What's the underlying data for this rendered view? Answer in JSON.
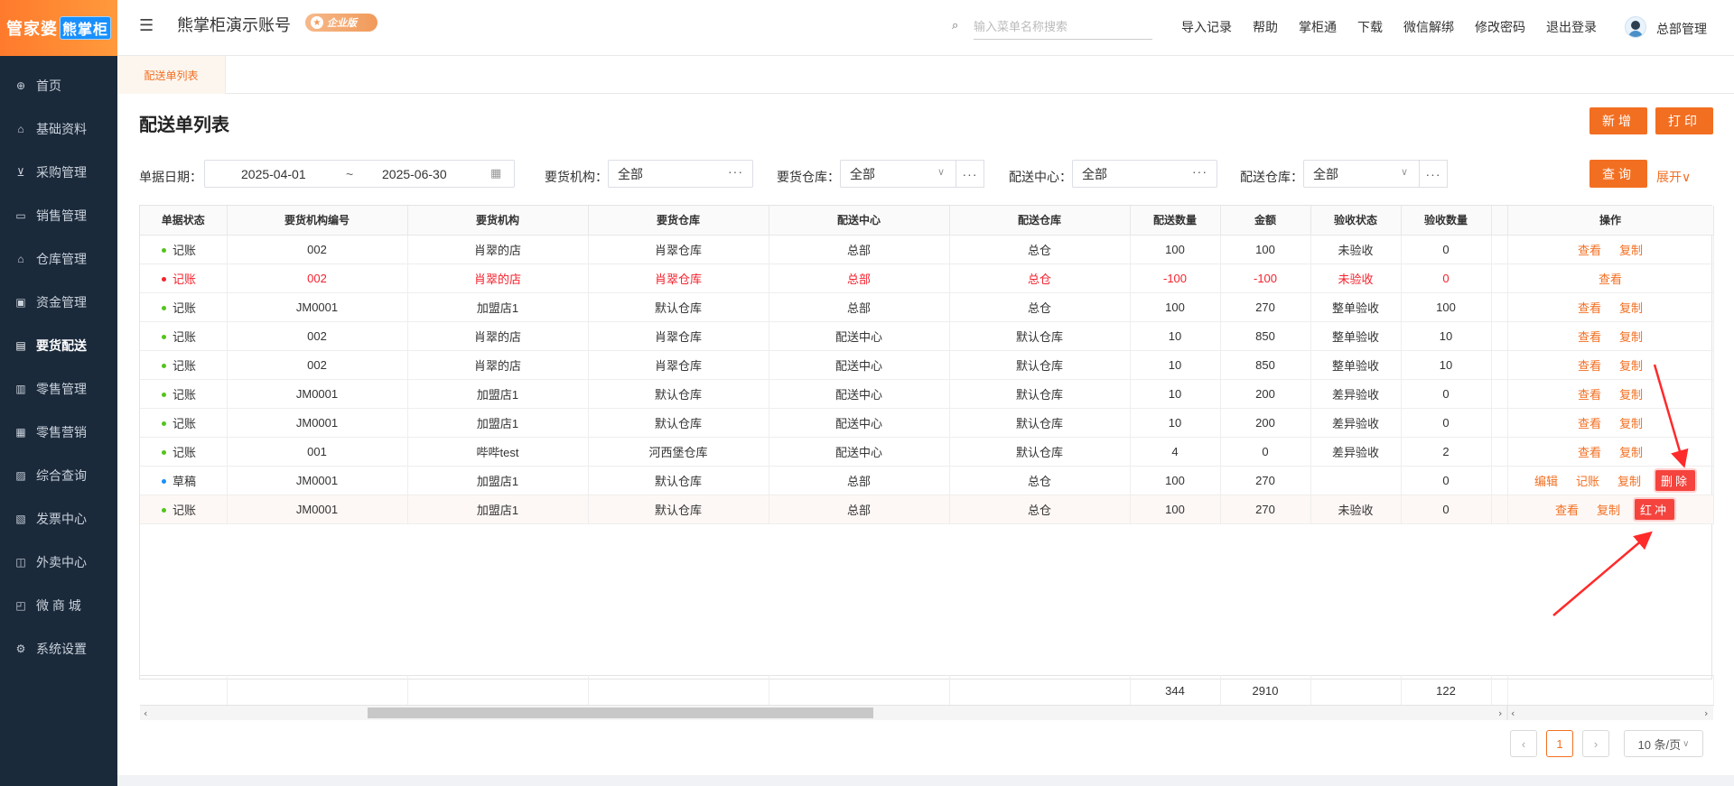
{
  "app": {
    "logo_text": "管家婆",
    "logo_sub": "熊掌柜",
    "account_title": "熊掌柜演示账号",
    "badge": "企业版"
  },
  "header": {
    "search_placeholder": "输入菜单名称搜索",
    "links": [
      "导入记录",
      "帮助",
      "掌柜通",
      "下载",
      "微信解绑",
      "修改密码",
      "退出登录"
    ],
    "user_name": "总部管理"
  },
  "sidebar": {
    "items": [
      {
        "label": "首页",
        "icon": "globe-icon",
        "glyph": "⊕"
      },
      {
        "label": "基础资料",
        "icon": "home-icon",
        "glyph": "⌂"
      },
      {
        "label": "采购管理",
        "icon": "cart-icon",
        "glyph": "⊻"
      },
      {
        "label": "销售管理",
        "icon": "sales-icon",
        "glyph": "▭"
      },
      {
        "label": "仓库管理",
        "icon": "warehouse-icon",
        "glyph": "⌂"
      },
      {
        "label": "资金管理",
        "icon": "funds-icon",
        "glyph": "▣"
      },
      {
        "label": "要货配送",
        "icon": "delivery-icon",
        "glyph": "▤"
      },
      {
        "label": "零售管理",
        "icon": "retail-icon",
        "glyph": "▥"
      },
      {
        "label": "零售营销",
        "icon": "gift-icon",
        "glyph": "▦"
      },
      {
        "label": "综合查询",
        "icon": "chart-icon",
        "glyph": "▨"
      },
      {
        "label": "发票中心",
        "icon": "invoice-icon",
        "glyph": "▧"
      },
      {
        "label": "外卖中心",
        "icon": "takeout-icon",
        "glyph": "◫"
      },
      {
        "label": "微 商 城",
        "icon": "shop-icon",
        "glyph": "◰"
      },
      {
        "label": "系统设置",
        "icon": "settings-icon",
        "glyph": "⚙"
      }
    ],
    "active_index": 6
  },
  "tabs": {
    "active": "配送单列表"
  },
  "page": {
    "title": "配送单列表",
    "new_btn": "新增",
    "print_btn": "打印",
    "query_btn": "查询",
    "expand": "展开",
    "filters": {
      "date_label": "单据日期：",
      "date_from": "2025-04-01",
      "date_sep": "~",
      "date_to": "2025-06-30",
      "org_label": "要货机构：",
      "org_value": "全部",
      "wh_label": "要货仓库：",
      "wh_value": "全部",
      "center_label": "配送中心：",
      "center_value": "全部",
      "dwh_label": "配送仓库：",
      "dwh_value": "全部"
    }
  },
  "table": {
    "columns": [
      "单据状态",
      "要货机构编号",
      "要货机构",
      "要货仓库",
      "配送中心",
      "配送仓库",
      "配送数量",
      "金额",
      "验收状态",
      "验收数量",
      "操作"
    ],
    "rows": [
      {
        "status": "记账",
        "dot": "g",
        "code": "002",
        "org": "肖翠的店",
        "wh": "肖翠仓库",
        "center": "总部",
        "dwh": "总仓",
        "qty": "100",
        "amt": "100",
        "acc": "未验收",
        "accqty": "0",
        "ops": [
          "查看",
          "复制"
        ],
        "style": ""
      },
      {
        "status": "记账",
        "dot": "r",
        "code": "002",
        "org": "肖翠的店",
        "wh": "肖翠仓库",
        "center": "总部",
        "dwh": "总仓",
        "qty": "-100",
        "amt": "-100",
        "acc": "未验收",
        "accqty": "0",
        "ops": [
          "查看"
        ],
        "style": "red"
      },
      {
        "status": "记账",
        "dot": "g",
        "code": "JM0001",
        "org": "加盟店1",
        "wh": "默认仓库",
        "center": "总部",
        "dwh": "总仓",
        "qty": "100",
        "amt": "270",
        "acc": "整单验收",
        "accqty": "100",
        "ops": [
          "查看",
          "复制"
        ],
        "style": ""
      },
      {
        "status": "记账",
        "dot": "g",
        "code": "002",
        "org": "肖翠的店",
        "wh": "肖翠仓库",
        "center": "配送中心",
        "dwh": "默认仓库",
        "qty": "10",
        "amt": "850",
        "acc": "整单验收",
        "accqty": "10",
        "ops": [
          "查看",
          "复制"
        ],
        "style": ""
      },
      {
        "status": "记账",
        "dot": "g",
        "code": "002",
        "org": "肖翠的店",
        "wh": "肖翠仓库",
        "center": "配送中心",
        "dwh": "默认仓库",
        "qty": "10",
        "amt": "850",
        "acc": "整单验收",
        "accqty": "10",
        "ops": [
          "查看",
          "复制"
        ],
        "style": ""
      },
      {
        "status": "记账",
        "dot": "g",
        "code": "JM0001",
        "org": "加盟店1",
        "wh": "默认仓库",
        "center": "配送中心",
        "dwh": "默认仓库",
        "qty": "10",
        "amt": "200",
        "acc": "差异验收",
        "accqty": "0",
        "ops": [
          "查看",
          "复制"
        ],
        "style": ""
      },
      {
        "status": "记账",
        "dot": "g",
        "code": "JM0001",
        "org": "加盟店1",
        "wh": "默认仓库",
        "center": "配送中心",
        "dwh": "默认仓库",
        "qty": "10",
        "amt": "200",
        "acc": "差异验收",
        "accqty": "0",
        "ops": [
          "查看",
          "复制"
        ],
        "style": ""
      },
      {
        "status": "记账",
        "dot": "g",
        "code": "001",
        "org": "哔哔test",
        "wh": "河西堡仓库",
        "center": "配送中心",
        "dwh": "默认仓库",
        "qty": "4",
        "amt": "0",
        "acc": "差异验收",
        "accqty": "2",
        "ops": [
          "查看",
          "复制"
        ],
        "style": ""
      },
      {
        "status": "草稿",
        "dot": "b",
        "code": "JM0001",
        "org": "加盟店1",
        "wh": "默认仓库",
        "center": "总部",
        "dwh": "总仓",
        "qty": "100",
        "amt": "270",
        "acc": "",
        "accqty": "0",
        "ops": [
          "编辑",
          "记账",
          "复制"
        ],
        "danger": "删除",
        "style": ""
      },
      {
        "status": "记账",
        "dot": "g",
        "code": "JM0001",
        "org": "加盟店1",
        "wh": "默认仓库",
        "center": "总部",
        "dwh": "总仓",
        "qty": "100",
        "amt": "270",
        "acc": "未验收",
        "accqty": "0",
        "ops": [
          "查看",
          "复制"
        ],
        "danger": "红冲",
        "style": "hl"
      }
    ],
    "totals": {
      "qty": "344",
      "amt": "2910",
      "accqty": "122"
    }
  },
  "pagination": {
    "current": "1",
    "page_size": "10 条/页"
  },
  "colors": {
    "accent": "#f26f22",
    "danger": "#f5433d",
    "sidebar": "#1b2a3b"
  }
}
